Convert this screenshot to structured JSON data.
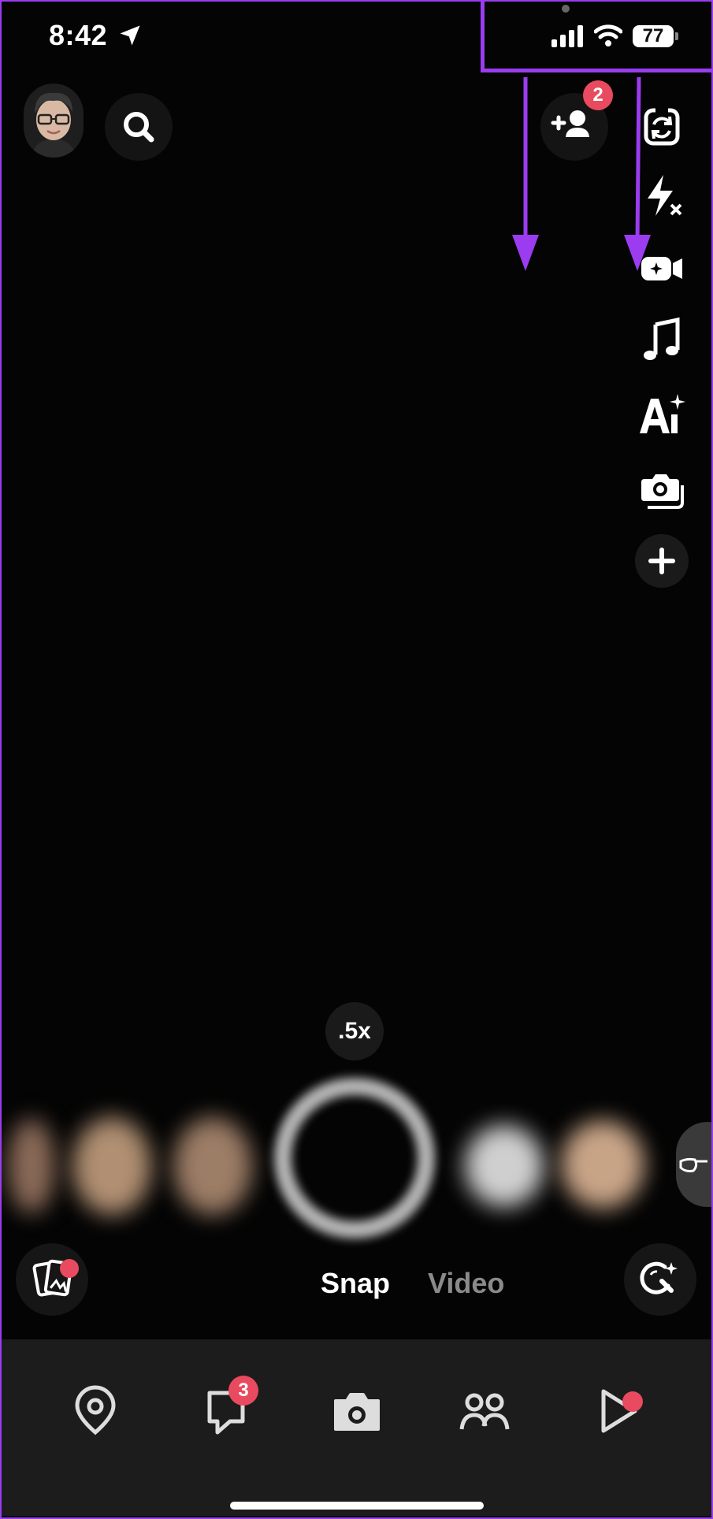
{
  "status_bar": {
    "time": "8:42",
    "battery": "77"
  },
  "camera": {
    "zoom_label": ".5x"
  },
  "top_bar": {
    "add_friend_badge": "2"
  },
  "modes": {
    "snap": "Snap",
    "video": "Video"
  },
  "nav": {
    "chat_badge": "3"
  },
  "icons": {
    "side": [
      "flip-camera-icon",
      "flash-off-icon",
      "dual-camera-icon",
      "music-icon",
      "ai-sparkle-icon",
      "multi-capture-icon",
      "plus-icon"
    ]
  },
  "colors": {
    "accent": "#9b3cf0",
    "badge": "#e84a5f"
  }
}
